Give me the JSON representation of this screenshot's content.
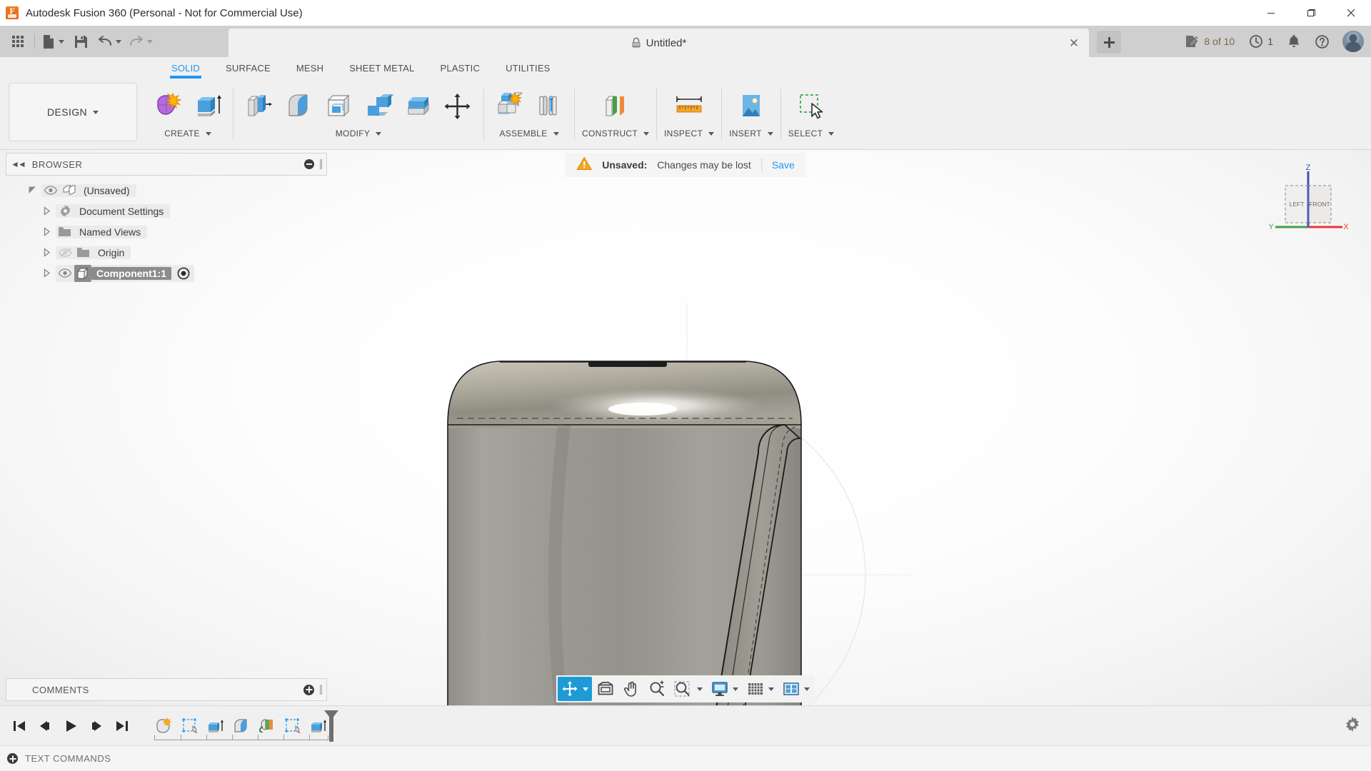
{
  "window": {
    "title": "Autodesk Fusion 360 (Personal - Not for Commercial Use)",
    "app_icon": "fusion-logo-icon",
    "minimize": "minimize-icon",
    "maximize": "maximize-icon",
    "close": "close-icon"
  },
  "quick_access": {
    "items": [
      {
        "name": "app-grid-icon",
        "label": "Show Data Panel"
      },
      {
        "name": "file-icon",
        "label": "File"
      },
      {
        "name": "save-icon",
        "label": "Save"
      },
      {
        "name": "undo-icon",
        "label": "Undo"
      },
      {
        "name": "redo-icon",
        "label": "Redo"
      }
    ],
    "doc_tab": {
      "name": "Untitled*",
      "lock_icon": "lock-icon",
      "close_icon": "close-icon"
    },
    "new_tab_label": "+",
    "status": {
      "edit_count": "8 of 10",
      "edit_icon": "edit-document-icon",
      "history_count": "1",
      "history_icon": "clock-icon",
      "notifications_icon": "bell-icon",
      "help_icon": "help-icon",
      "avatar_icon": "user-avatar"
    }
  },
  "ribbon": {
    "tabs": [
      {
        "label": "SOLID",
        "active": true
      },
      {
        "label": "SURFACE",
        "active": false
      },
      {
        "label": "MESH",
        "active": false
      },
      {
        "label": "SHEET METAL",
        "active": false
      },
      {
        "label": "PLASTIC",
        "active": false
      },
      {
        "label": "UTILITIES",
        "active": false
      }
    ],
    "workspace": {
      "label": "DESIGN"
    },
    "groups": [
      {
        "label": "CREATE",
        "icons": [
          "create-form-icon",
          "extrude-icon"
        ]
      },
      {
        "label": "MODIFY",
        "icons": [
          "press-pull-icon",
          "fillet-icon",
          "shell-icon",
          "combine-icon",
          "split-face-icon",
          "move-copy-icon"
        ]
      },
      {
        "label": "ASSEMBLE",
        "icons": [
          "new-component-icon",
          "joint-icon"
        ]
      },
      {
        "label": "CONSTRUCT",
        "icons": [
          "offset-plane-icon"
        ]
      },
      {
        "label": "INSPECT",
        "icons": [
          "measure-icon"
        ]
      },
      {
        "label": "INSERT",
        "icons": [
          "insert-image-icon"
        ]
      },
      {
        "label": "SELECT",
        "icons": [
          "select-window-icon"
        ]
      }
    ]
  },
  "browser": {
    "header": {
      "title": "BROWSER",
      "collapse_icon": "collapse-left-icon",
      "minimize_icon": "minus-circle-icon"
    },
    "items": [
      {
        "label": "(Unsaved)",
        "indent": 0,
        "expander": "expanded",
        "eye": "visible",
        "icon": "document-icon",
        "selected": false
      },
      {
        "label": "Document Settings",
        "indent": 1,
        "expander": "collapsed",
        "eye": "none",
        "icon": "gear-icon",
        "selected": false
      },
      {
        "label": "Named Views",
        "indent": 1,
        "expander": "collapsed",
        "eye": "none",
        "icon": "folder-icon",
        "selected": false
      },
      {
        "label": "Origin",
        "indent": 1,
        "expander": "collapsed",
        "eye": "hidden",
        "icon": "folder-icon",
        "selected": false
      },
      {
        "label": "Component1:1",
        "indent": 1,
        "expander": "collapsed",
        "eye": "visible",
        "icon": "component-icon",
        "selected": true
      }
    ]
  },
  "banner": {
    "warning_icon": "warning-icon",
    "label": "Unsaved:",
    "message": "Changes may be lost",
    "action": "Save"
  },
  "viewcube": {
    "face_left": "LEFT",
    "face_front": "FRONT",
    "axis_x": "X",
    "axis_y": "Y",
    "axis_z": "Z",
    "color_x": "#e53935",
    "color_y": "#43a047",
    "color_z": "#3f51b5"
  },
  "comments": {
    "header": {
      "title": "COMMENTS",
      "add_icon": "plus-circle-icon"
    }
  },
  "navbar": {
    "items": [
      {
        "name": "orbit-icon",
        "label": "Orbit",
        "active": true,
        "caret": true
      },
      {
        "name": "look-at-icon",
        "label": "Look At",
        "active": false,
        "caret": false
      },
      {
        "name": "pan-icon",
        "label": "Pan",
        "active": false,
        "caret": false
      },
      {
        "name": "zoom-icon",
        "label": "Zoom",
        "active": false,
        "caret": false
      },
      {
        "name": "zoom-window-icon",
        "label": "Fit",
        "active": false,
        "caret": true
      },
      {
        "name": "display-settings-icon",
        "label": "Display Settings",
        "active": false,
        "caret": true
      },
      {
        "name": "grid-snaps-icon",
        "label": "Grid and Snaps",
        "active": false,
        "caret": true
      },
      {
        "name": "viewports-icon",
        "label": "Viewports",
        "active": false,
        "caret": true
      }
    ]
  },
  "timeline": {
    "playback": [
      {
        "name": "timeline-jump-start-icon",
        "label": "Jump to Beginning"
      },
      {
        "name": "timeline-step-back-icon",
        "label": "Step Back"
      },
      {
        "name": "timeline-play-icon",
        "label": "Play"
      },
      {
        "name": "timeline-step-forward-icon",
        "label": "Step Forward"
      },
      {
        "name": "timeline-jump-end-icon",
        "label": "Jump to End"
      }
    ],
    "features": [
      {
        "name": "timeline-feature-form-icon",
        "label": "Create Form"
      },
      {
        "name": "timeline-feature-sketch-icon",
        "label": "Sketch"
      },
      {
        "name": "timeline-feature-extrude-icon",
        "label": "Extrude"
      },
      {
        "name": "timeline-feature-fillet-icon",
        "label": "Fillet"
      },
      {
        "name": "timeline-feature-appearance-icon",
        "label": "Appearance"
      },
      {
        "name": "timeline-feature-sketch-icon",
        "label": "Sketch"
      },
      {
        "name": "timeline-feature-extrude-icon",
        "label": "Extrude"
      }
    ],
    "settings_icon": "gear-icon"
  },
  "statusbar": {
    "add_icon": "plus-circle-icon",
    "text": "TEXT COMMANDS"
  },
  "model": {
    "description": "metallic rounded cylinder body with vertical handle",
    "base_color": "#9b9a92",
    "highlight_color": "#ffffff",
    "edge_color": "#1a1a1a"
  }
}
